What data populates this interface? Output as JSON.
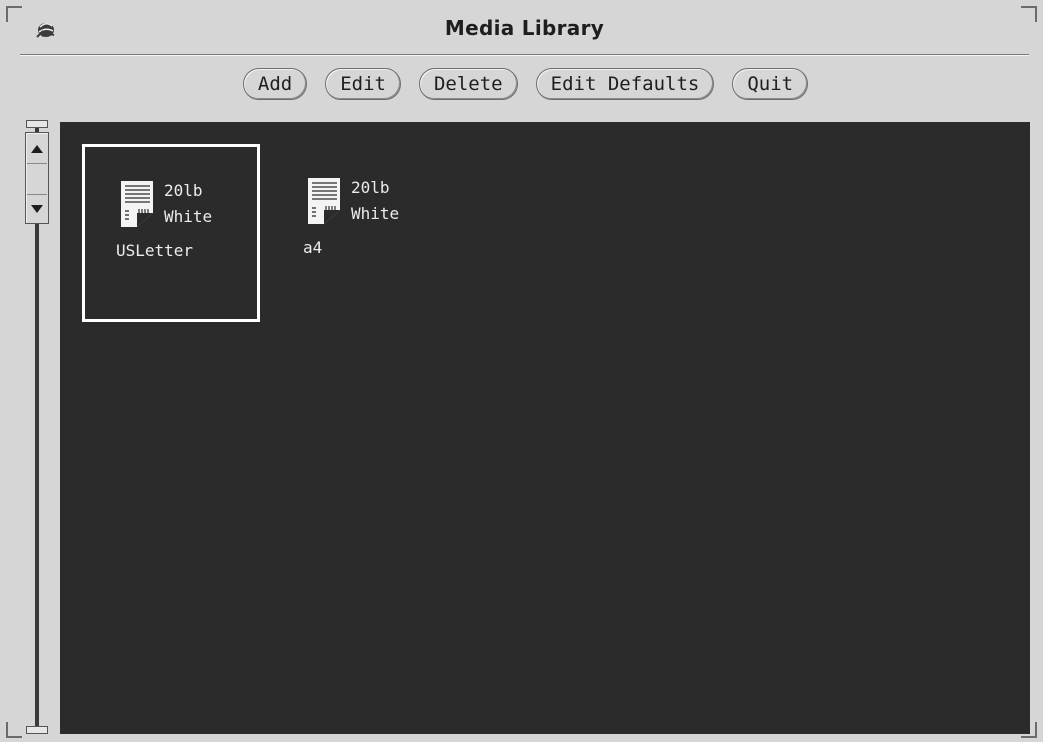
{
  "window": {
    "title": "Media Library"
  },
  "toolbar": {
    "add_label": "Add",
    "edit_label": "Edit",
    "delete_label": "Delete",
    "edit_defaults_label": "Edit Defaults",
    "quit_label": "Quit"
  },
  "media": [
    {
      "weight": "20lb",
      "color": "White",
      "name": "USLetter",
      "selected": true
    },
    {
      "weight": "20lb",
      "color": "White",
      "name": "a4",
      "selected": false
    }
  ],
  "icons": {
    "window_menu": "window-menu-icon",
    "media_sheet": "paper-sheet-icon",
    "scroll_up": "arrow-up-icon",
    "scroll_down": "arrow-down-icon"
  },
  "colors": {
    "window_bg": "#d6d6d6",
    "canvas_bg": "#2b2b2b",
    "selection": "#ffffff",
    "text_light": "#ececec"
  }
}
